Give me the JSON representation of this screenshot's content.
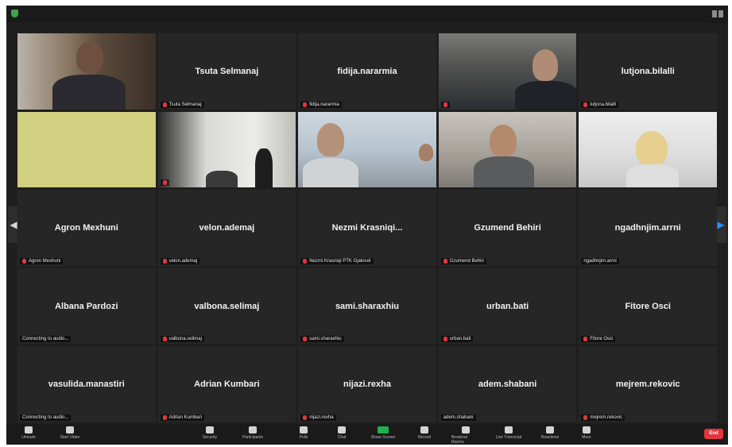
{
  "topbar": {
    "shield_icon": "shield-icon",
    "view_icon": "speaker-view-icon"
  },
  "tiles": [
    {
      "center": "",
      "label": ""
    },
    {
      "center": "Tsuta Selmanaj",
      "label": "Tsuta Selmanaj"
    },
    {
      "center": "fidija.nararmia",
      "label": "fidija.nararmia"
    },
    {
      "center": "",
      "label": ""
    },
    {
      "center": "lutjona.bilalli",
      "label": "lutjona.bilalli"
    },
    {
      "center": "",
      "label": ""
    },
    {
      "center": "",
      "label": ""
    },
    {
      "center": "",
      "label": ""
    },
    {
      "center": "",
      "label": ""
    },
    {
      "center": "",
      "label": ""
    },
    {
      "center": "Agron Mexhuni",
      "label": "Agron Mexhuni"
    },
    {
      "center": "velon.ademaj",
      "label": "velon.ademaj"
    },
    {
      "center": "Nezmi  Krasniqi...",
      "label": "Nezmi Krasniqi PTK Gjakovë"
    },
    {
      "center": "Gzumend Behiri",
      "label": "Gzumend Behiri"
    },
    {
      "center": "ngadhnjim.arrni",
      "label": "ngadhnjim.arrni"
    },
    {
      "center": "Albana Pardozi",
      "label": "Connecting to audio..."
    },
    {
      "center": "valbona.selimaj",
      "label": "valbona.selimaj"
    },
    {
      "center": "sami.sharaxhiu",
      "label": "sami.sharaxhiu"
    },
    {
      "center": "urban.bati",
      "label": "urban.bati"
    },
    {
      "center": "Fitore Osci",
      "label": "Fitore Osci"
    },
    {
      "center": "vasulida.manastiri",
      "label": "Connecting to audio..."
    },
    {
      "center": "Adrian Kumbari",
      "label": "Adrian Kumbari"
    },
    {
      "center": "nijazi.rexha",
      "label": "nijazi.rexha"
    },
    {
      "center": "adem.shabani",
      "label": "adem.shabani"
    },
    {
      "center": "mejrem.rekovic",
      "label": "mejrem.rekovic"
    }
  ],
  "toolbar": {
    "unmute": "Unmute",
    "start_video": "Start Video",
    "security": "Security",
    "participants": "Participants",
    "participants_count": "65",
    "polls": "Polls",
    "chat": "Chat",
    "share_screen": "Share Screen",
    "record": "Record",
    "breakout_rooms": "Breakout Rooms",
    "live_transcript": "Live Transcript",
    "reactions": "Reactions",
    "more": "More",
    "end": "End"
  }
}
